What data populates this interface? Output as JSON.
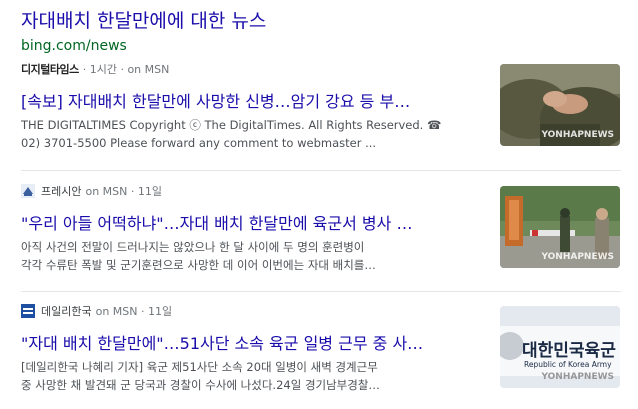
{
  "header": {
    "title": "자대배치 한달만에에 대한 뉴스",
    "source": "bing.com/news"
  },
  "articles": [
    {
      "publisher": "디지털타임스",
      "meta": "· 1시간 · on MSN",
      "headline": "[속보] 자대배치 한달만에 사망한 신병…암기 강요 등 부…",
      "snippet1": "THE DIGITALTIMES Copyright ⓒ The DigitalTimes. All Rights Reserved. ☎",
      "snippet2": "02) 3701-5500 Please forward any comment to webmaster ...",
      "thumb_caption": "YONHAPNEWS"
    },
    {
      "publisher": "프레시안",
      "meta": "on MSN · 11일",
      "headline": "\"우리 아들 어떡하냐\"…자대 배치 한달만에 육군서 병사 …",
      "snippet1": "아직 사건의 전말이 드러나지는 않았으나 한 달 사이에 두 명의 훈련병이",
      "snippet2": "각각 수류탄 폭발 및 군기훈련으로 사망한 데 이어 이번에는 자대 배치를…",
      "thumb_caption": "YONHAPNEWS"
    },
    {
      "publisher": "데일리한국",
      "meta": "on MSN · 11일",
      "headline": "\"자대 배치 한달만에\"…51사단 소속 육군 일병 근무 중 사…",
      "snippet1": "[데일리한국 나혜리 기자] 육군 제51사단 소속 20대 일병이 새벽 경계근무",
      "snippet2": "중 사망한 채 발견돼 군 당국과 경찰이 수사에 나섰다.24일 경기남부경찰…",
      "thumb_text1": "대한민국육군",
      "thumb_text2": "Republic of Korea Army",
      "thumb_caption": "YONHAPNEWS"
    }
  ],
  "colors": {
    "link": "#1a0dab",
    "url": "#006621",
    "meta": "#70757a",
    "snippet": "#4d5156"
  }
}
